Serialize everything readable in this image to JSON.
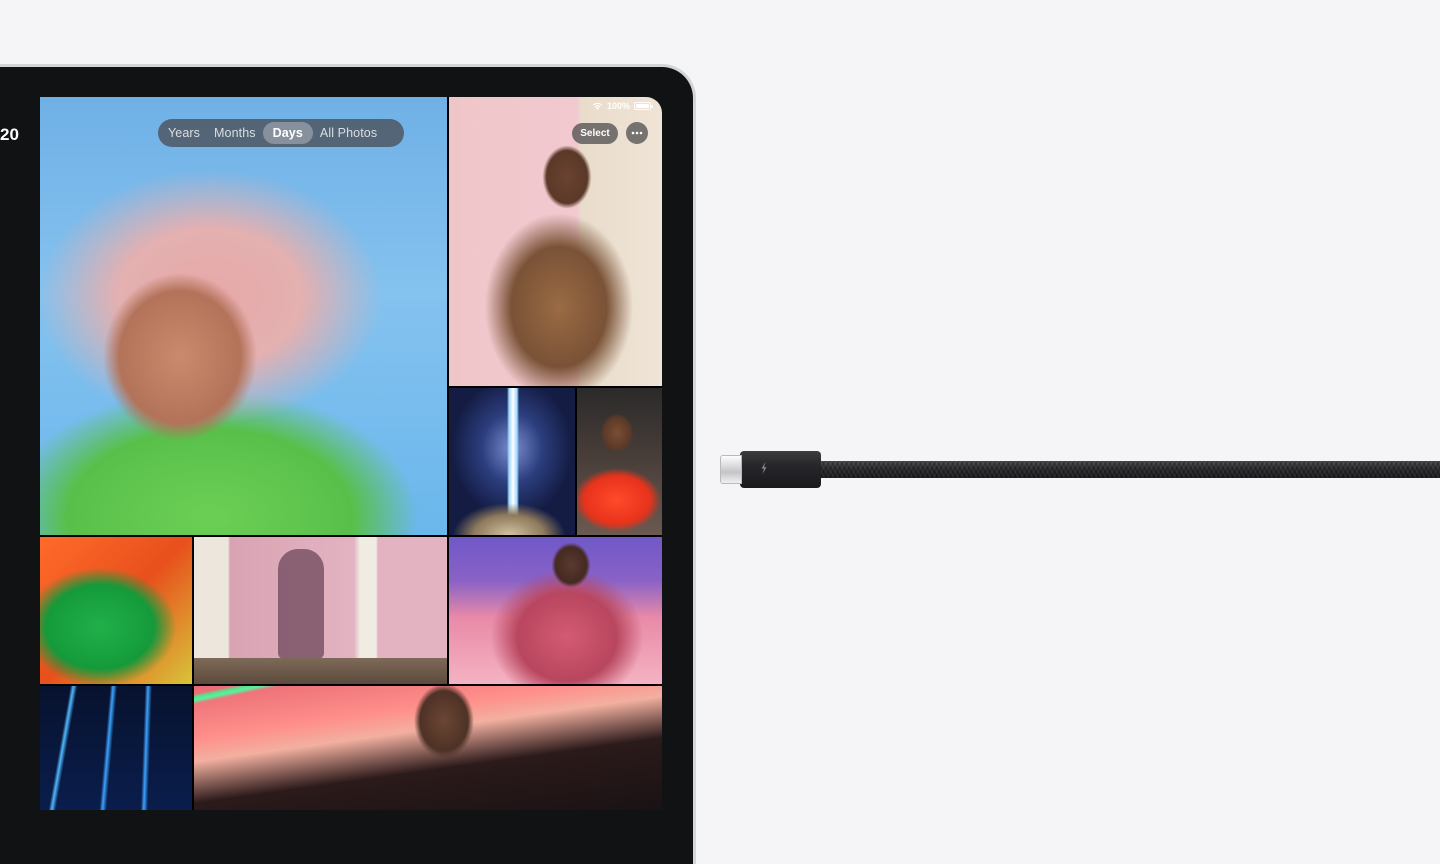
{
  "photos": {
    "header": {
      "year_partial": "20",
      "segments": [
        {
          "label": "Years",
          "active": false
        },
        {
          "label": "Months",
          "active": false
        },
        {
          "label": "Days",
          "active": true
        },
        {
          "label": "All Photos",
          "active": false
        }
      ],
      "select_label": "Select"
    },
    "status_bar": {
      "battery_text": "100%"
    }
  },
  "icons": {
    "more": "ellipsis-icon",
    "wifi": "wifi-icon",
    "battery": "battery-icon",
    "thunderbolt": "thunderbolt-bolt-icon"
  },
  "colors": {
    "page_background": "#f5f5f7",
    "device_frame": "#d4d5d7",
    "bezel": "#111214",
    "cable": "#2a2a2d"
  }
}
